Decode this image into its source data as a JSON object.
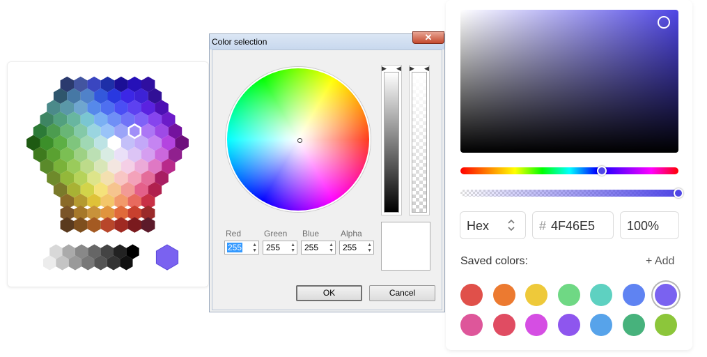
{
  "hex_picker": {
    "palette_rows": [
      [
        "#2b3a6e",
        "#4355a0",
        "#3a46c0",
        "#1e2fa8",
        "#1b0f96",
        "#2610b8",
        "#2f0fa0"
      ],
      [
        "#2f566d",
        "#4678a5",
        "#5082c9",
        "#3358dc",
        "#2938e0",
        "#3c27e6",
        "#3d22d6",
        "#311096"
      ],
      [
        "#4b8a8a",
        "#5a98a8",
        "#6fa6cf",
        "#5689ea",
        "#4e6ff0",
        "#4a4ef4",
        "#5d41f0",
        "#5a22e0",
        "#4c0fb4"
      ],
      [
        "#3e8563",
        "#52a07e",
        "#68b6a0",
        "#7ac6d2",
        "#7ab0f3",
        "#6f8ff6",
        "#7073f7",
        "#7f62f7",
        "#8644ee",
        "#6c1bc9"
      ],
      [
        "#2c7a37",
        "#4c9c4f",
        "#69b676",
        "#84c9a8",
        "#9ad5e0",
        "#99c3f8",
        "#9ba4f8",
        "#a18ff8",
        "#ac76f5",
        "#9e4ae6",
        "#74129e"
      ],
      [
        "#1e5a12",
        "#3c8f2a",
        "#5daf45",
        "#7fc57d",
        "#a0d8b4",
        "#bde3e4",
        "#ffffff",
        "#c3bff9",
        "#c3a8f8",
        "#c584f2",
        "#b444e0",
        "#6e0f7d"
      ],
      [
        "#3e7a1d",
        "#5aa131",
        "#7bbf53",
        "#9ed184",
        "#bce0b4",
        "#d9ece3",
        "#eae0f8",
        "#dcc4f5",
        "#d59ef0",
        "#cb68dc",
        "#90208e"
      ],
      [
        "#5a8a2a",
        "#7ab23a",
        "#9acb5b",
        "#bddb8a",
        "#d8e6b8",
        "#f3e6e0",
        "#f4cfe6",
        "#ecaad8",
        "#df78c4",
        "#b82a8a"
      ],
      [
        "#6e8a2b",
        "#93b83a",
        "#b6d35a",
        "#dde48a",
        "#f3e0b0",
        "#f8c6c4",
        "#f3a2ba",
        "#e46c9a",
        "#a81e62"
      ],
      [
        "#7a7a2a",
        "#a8b234",
        "#d2d44a",
        "#f5e27a",
        "#f6c48e",
        "#f29a96",
        "#e4608a",
        "#b0204e"
      ],
      [
        "#8a6a28",
        "#b49a30",
        "#dfc238",
        "#f3c66a",
        "#f29a6a",
        "#e86a5e",
        "#c83046"
      ],
      [
        "#7a5428",
        "#a6782a",
        "#c8923a",
        "#e0943e",
        "#e06a3a",
        "#c8402e",
        "#9a2a2a"
      ],
      [
        "#5a3a1e",
        "#7e4f1e",
        "#a45a22",
        "#b8462a",
        "#a02a22",
        "#7a1a1e",
        "#5c1a2a"
      ]
    ],
    "selected_cell": {
      "row": 4,
      "col": 7
    },
    "gray_rows": [
      [
        "#ffffff",
        "#d8d8d8",
        "#aaaaaa",
        "#888888",
        "#666666",
        "#444444",
        "#222222",
        "#000000"
      ],
      [
        "#ececec",
        "#c4c4c4",
        "#9a9a9a",
        "#787878",
        "#555555",
        "#333333",
        "#111111"
      ]
    ],
    "current_color": "#7a62f0"
  },
  "dialog": {
    "title": "Color selection",
    "close_glyph": "✕",
    "labels": {
      "red": "Red",
      "green": "Green",
      "blue": "Blue",
      "alpha": "Alpha"
    },
    "values": {
      "red": "255",
      "green": "255",
      "blue": "255",
      "alpha": "255"
    },
    "preview_color": "#ffffff",
    "ok_label": "OK",
    "cancel_label": "Cancel"
  },
  "modern": {
    "base_color": "#4F46E5",
    "hue_fraction": 0.65,
    "alpha_fraction": 1.0,
    "format": "Hex",
    "hex_prefix": "#",
    "hex_value": "4F46E5",
    "alpha_value": "100%",
    "saved_label": "Saved colors:",
    "add_label": "+ Add",
    "swatches": [
      [
        "#e0504a",
        "#ec7a30",
        "#eec93a",
        "#6fd884",
        "#5ed1c1",
        "#5f83f2",
        "#7a62f0"
      ],
      [
        "#de569a",
        "#e04c62",
        "#d54ee3",
        "#8e56ee",
        "#57a3ea",
        "#47b27c",
        "#8cc63a"
      ]
    ],
    "selected_swatch": {
      "row": 0,
      "col": 6
    }
  }
}
